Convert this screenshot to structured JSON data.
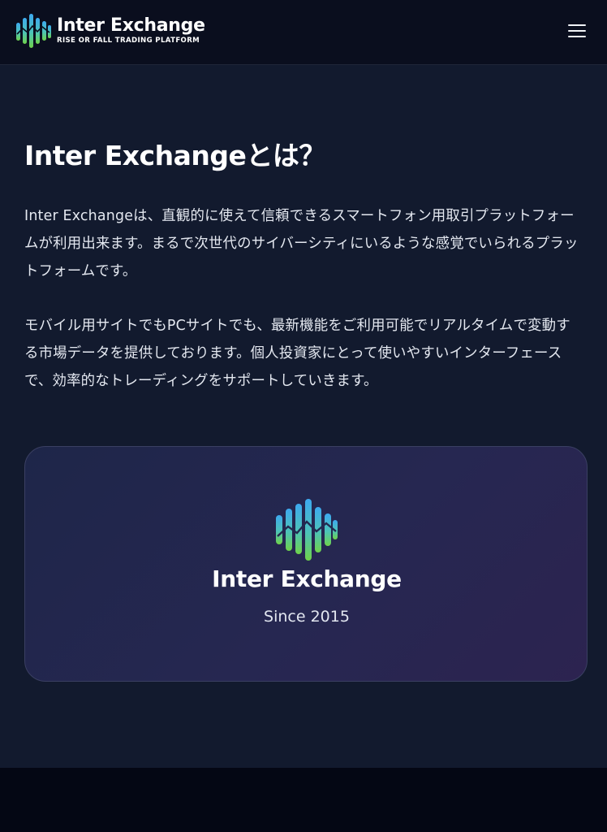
{
  "header": {
    "brand_name": "Inter Exchange",
    "brand_tagline": "RISE OR FALL TRADING PLATFORM",
    "logo_icon": "equalizer-bars-logo-icon",
    "menu_icon": "hamburger-menu-icon"
  },
  "about": {
    "title": "Inter Exchangeとは？",
    "paragraph_1": "Inter Exchangeは、直観的に使えて信頼できるスマートフォン用取引プラットフォームが利用出来ます。まるで次世代のサイバーシティにいるような感覚でいられるプラットフォームです。",
    "paragraph_2": "モバイル用サイトでもPCサイトでも、最新機能をご利用可能でリアルタイムで変動する市場データを提供しております。個人投資家にとって使いやすいインターフェースで、効率的なトレーディングをサポートしていきます。"
  },
  "card": {
    "name": "Inter Exchange",
    "since": "Since 2015"
  },
  "colors": {
    "header_bg": "#0a0e1e",
    "main_bg": "#121a2e",
    "footer_bg": "#040714",
    "logo_blue": "#3da9f0",
    "logo_green": "#6fd24a"
  }
}
